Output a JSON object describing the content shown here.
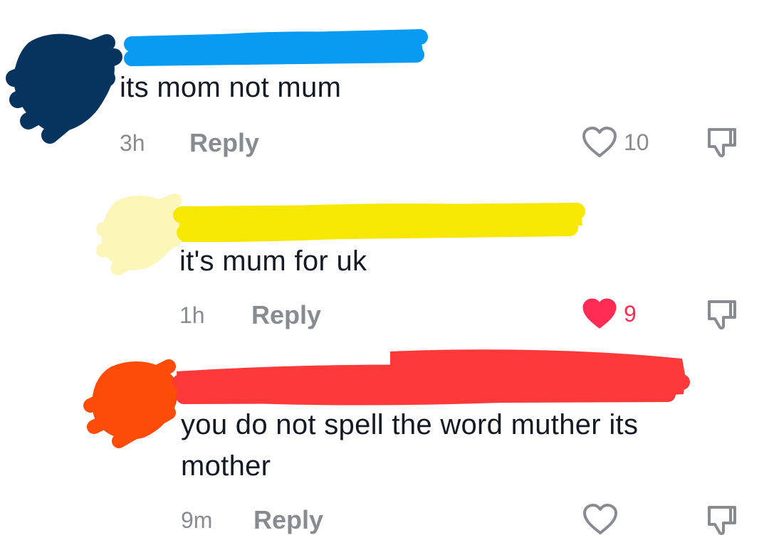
{
  "comments": [
    {
      "text": "its mom not mum",
      "time": "3h",
      "reply_label": "Reply",
      "like_count": "10",
      "liked": false
    },
    {
      "text": "it's mum for uk",
      "time": "1h",
      "reply_label": "Reply",
      "like_count": "9",
      "liked": true
    },
    {
      "text": "you do not spell the word muther its\nmother",
      "time": "9m",
      "reply_label": "Reply",
      "like_count": "",
      "liked": false
    }
  ],
  "colors": {
    "avatar_scribble_1": "#06345e",
    "name_scribble_1": "#099af3",
    "avatar_scribble_2": "#fdf6b9",
    "name_scribble_2": "#f7e803",
    "avatar_scribble_3": "#fd4b08",
    "name_scribble_3": "#fd3a39",
    "liked_heart": "#fe2c55",
    "meta_gray": "#8a8b91",
    "text": "#161823"
  },
  "icons": {
    "like": "heart-icon",
    "dislike": "thumbs-down-icon"
  }
}
